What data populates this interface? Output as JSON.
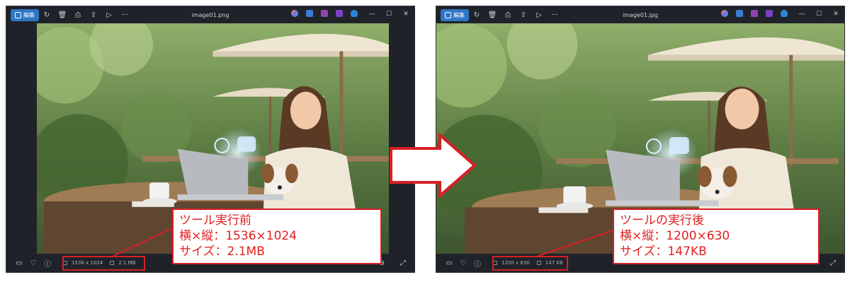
{
  "before": {
    "window_title": "image01.png",
    "edit_label": "編集",
    "dimensions": "1536 x 1024",
    "size": "2.1 MB",
    "callout": [
      "ツール実行前",
      "横×縦：1536×1024",
      "サイズ：2.1MB"
    ]
  },
  "after": {
    "window_title": "image01.jpg",
    "edit_label": "編集",
    "dimensions": "1200 x 630",
    "size": "147 KB",
    "callout": [
      "ツールの実行後",
      "横×縦：1200×630",
      "サイズ：147KB"
    ]
  },
  "icons": {
    "rotate": "rotate-icon",
    "delete": "trash-icon",
    "print": "printer-icon",
    "share": "share-icon",
    "slideshow": "slideshow-icon",
    "more": "more-icon",
    "minimize": "minimize-icon",
    "maximize": "maximize-icon",
    "close": "close-icon",
    "filmstrip": "filmstrip-icon",
    "favorite": "heart-icon",
    "info": "info-icon",
    "zoom": "zoom-icon",
    "fullscreen": "fullscreen-icon"
  },
  "colors": {
    "accent": "#2f76c6",
    "highlight": "#d81f26",
    "callout_text": "#e02020",
    "window_bg": "#1f2329"
  }
}
